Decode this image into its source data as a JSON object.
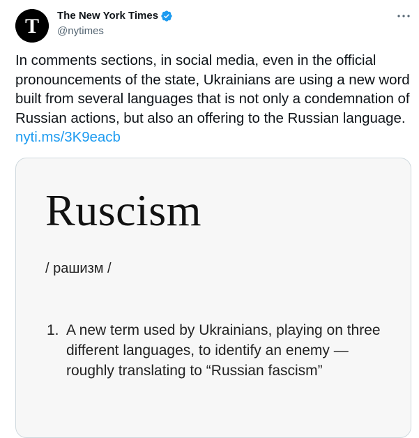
{
  "author": {
    "display_name": "The New York Times",
    "handle": "@nytimes",
    "verified": true,
    "avatar_icon": "nyt-logo-icon"
  },
  "more_icon": "more-options-icon",
  "tweet": {
    "text": "In comments sections, in social media, even in the official pronouncements of the state, Ukrainians are using a new word built from several languages that is not only a condemnation of Russian actions, but also an offering to the Russian language.",
    "link_text": "nyti.ms/3K9eacb"
  },
  "media": {
    "word": "Ruscism",
    "pronunciation": "/ рашизм /",
    "definition_number": "1.",
    "definition_text": "A new term used by Ukrainians, playing on three different languages, to identify an enemy — roughly translating to “Russian fascism”"
  },
  "colors": {
    "link": "#1d9bf0",
    "verified_badge": "#1d9bf0",
    "secondary_text": "#536471",
    "card_border": "#cfd9de",
    "card_background": "#f7f7f7"
  }
}
